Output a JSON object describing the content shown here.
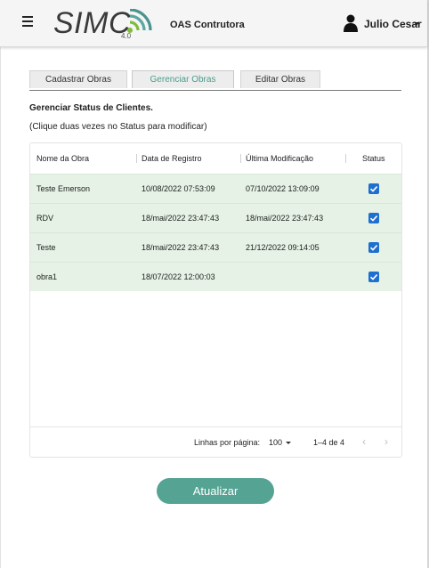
{
  "header": {
    "logo_text": "SIMC",
    "logo_version": "4.0",
    "company": "OAS Contrutora",
    "user_name": "Julio Cesar"
  },
  "tabs": [
    {
      "label": "Cadastrar Obras",
      "active": false
    },
    {
      "label": "Gerenciar Obras",
      "active": true
    },
    {
      "label": "Editar Obras",
      "active": false
    }
  ],
  "section": {
    "title": "Gerenciar Status de Clientes.",
    "hint": "(Clique duas vezes no Status para modificar)"
  },
  "table": {
    "columns": [
      "Nome da Obra",
      "Data de Registro",
      "Última Modificação",
      "Status"
    ],
    "rows": [
      {
        "name": "Teste Emerson",
        "registered": "10/08/2022 07:53:09",
        "modified": "07/10/2022 13:09:09",
        "status": true
      },
      {
        "name": "RDV",
        "registered": "18/mai/2022 23:47:43",
        "modified": "18/mai/2022 23:47:43",
        "status": true
      },
      {
        "name": "Teste",
        "registered": "18/mai/2022 23:47:43",
        "modified": "21/12/2022 09:14:05",
        "status": true
      },
      {
        "name": "obra1",
        "registered": "18/07/2022 12:00:03",
        "modified": "",
        "status": true
      }
    ],
    "footer": {
      "rows_per_page_label": "Linhas por página:",
      "rows_per_page_value": "100",
      "range": "1–4 de 4",
      "prev": "‹",
      "next": "›"
    }
  },
  "actions": {
    "update_label": "Atualizar"
  },
  "colors": {
    "accent": "#55a393",
    "active_tab_text": "#4b9c8a",
    "row_bg": "#e5f2e5",
    "checkbox": "#1f6fcf"
  },
  "icons": [
    "menu-icon",
    "signal-waves-icon",
    "user-icon",
    "chevron-down-icon",
    "checkbox-checked-icon",
    "chevron-left-icon",
    "chevron-right-icon"
  ]
}
